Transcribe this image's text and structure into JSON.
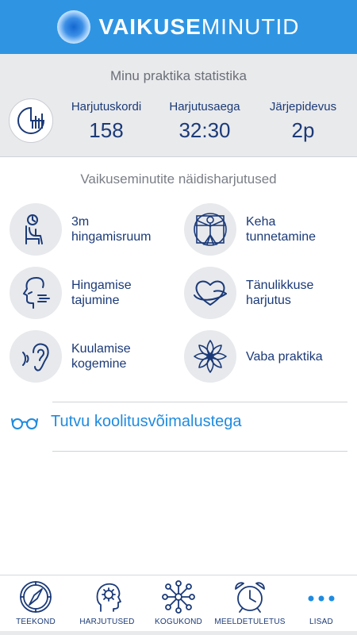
{
  "header": {
    "brand_bold": "VAIKUSE",
    "brand_light": "MINUTID"
  },
  "stats": {
    "title": "Minu praktika statistika",
    "items": [
      {
        "label": "Harjutuskordi",
        "value": "158"
      },
      {
        "label": "Harjutusaega",
        "value": "32:30"
      },
      {
        "label": "Järjepidevus",
        "value": "2p"
      }
    ]
  },
  "exercises": {
    "title": "Vaikuseminutite näidisharjutused",
    "items": [
      {
        "label": "3m\nhingamisruum",
        "icon": "clock-chair-icon"
      },
      {
        "label": "Keha\ntunnetamine",
        "icon": "vitruvian-body-icon"
      },
      {
        "label": "Hingamise\ntajumine",
        "icon": "face-breathing-icon"
      },
      {
        "label": "Tänulikkuse\nharjutus",
        "icon": "heart-icon"
      },
      {
        "label": "Kuulamise\nkogemine",
        "icon": "ear-icon"
      },
      {
        "label": "Vaba praktika",
        "icon": "lotus-icon"
      }
    ]
  },
  "course": {
    "label": "Tutvu koolitusvõimalustega",
    "icon": "glasses-icon"
  },
  "tabbar": {
    "items": [
      {
        "label": "TEEKOND",
        "icon": "compass-icon"
      },
      {
        "label": "HARJUTUSED",
        "icon": "head-gear-icon"
      },
      {
        "label": "KOGUKOND",
        "icon": "network-icon"
      },
      {
        "label": "MEELDETULETUS",
        "icon": "alarm-clock-icon"
      },
      {
        "label": "LISAD",
        "icon": "more-dots-icon"
      }
    ]
  },
  "colors": {
    "header_blue": "#2f95e3",
    "navy": "#1b3a78",
    "accent_blue": "#1f8be0",
    "stats_bg": "#e9eaec"
  }
}
